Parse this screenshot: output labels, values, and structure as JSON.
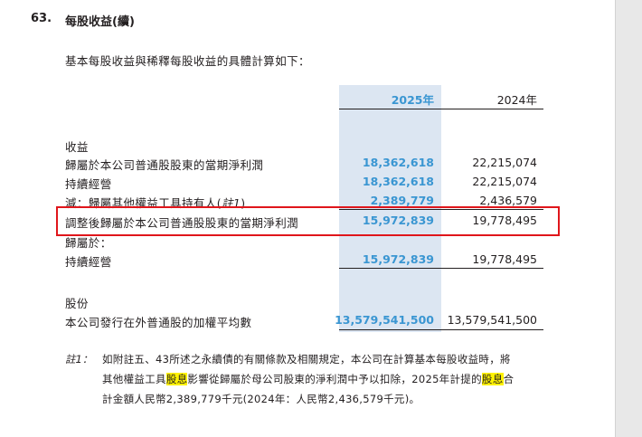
{
  "note": {
    "number": "63.",
    "title": "每股收益(續)"
  },
  "intro": "基本每股收益與稀釋每股收益的具體計算如下：",
  "columns": {
    "current": "2025年",
    "prior": "2024年"
  },
  "sections": {
    "earnings_heading": "收益",
    "shares_heading": "股份"
  },
  "rows": {
    "r1": {
      "label": "歸屬於本公司普通股股東的當期淨利潤",
      "v2025": "18,362,618",
      "v2024": "22,215,074"
    },
    "r2": {
      "label": "持續經營",
      "v2025": "18,362,618",
      "v2024": "22,215,074"
    },
    "r3": {
      "label_prefix": "減：歸屬其他權益工具持有人(",
      "label_note": "註1",
      "label_suffix": ")",
      "v2025": "2,389,779",
      "v2024": "2,436,579"
    },
    "r4": {
      "label": "調整後歸屬於本公司普通股股東的當期淨利潤",
      "v2025": "15,972,839",
      "v2024": "19,778,495"
    },
    "r5": {
      "label": "歸屬於："
    },
    "r6": {
      "label": "持續經營",
      "v2025": "15,972,839",
      "v2024": "19,778,495"
    },
    "r7": {
      "label": "本公司發行在外普通股的加權平均數",
      "v2025": "13,579,541,500",
      "v2024": "13,579,541,500"
    }
  },
  "footnote": {
    "label": "註1：",
    "line1": "如附註五、43所述之永續債的有關條款及相關規定，本公司在計算基本每股收益時，將",
    "line2_a": "其他權益工具",
    "line2_hl1": "股息",
    "line2_b": "影響從歸屬於母公司股東的淨利潤中予以扣除，2025年計提的",
    "line2_hl2": "股息",
    "line2_c": "合",
    "line3": "計金額人民幣2,389,779千元(2024年：人民幣2,436,579千元)。"
  },
  "colors": {
    "accent_blue": "#3a96d2",
    "column_band": "#dce6f2",
    "highlight_box": "#e0161b",
    "text_highlight": "#fff200"
  }
}
